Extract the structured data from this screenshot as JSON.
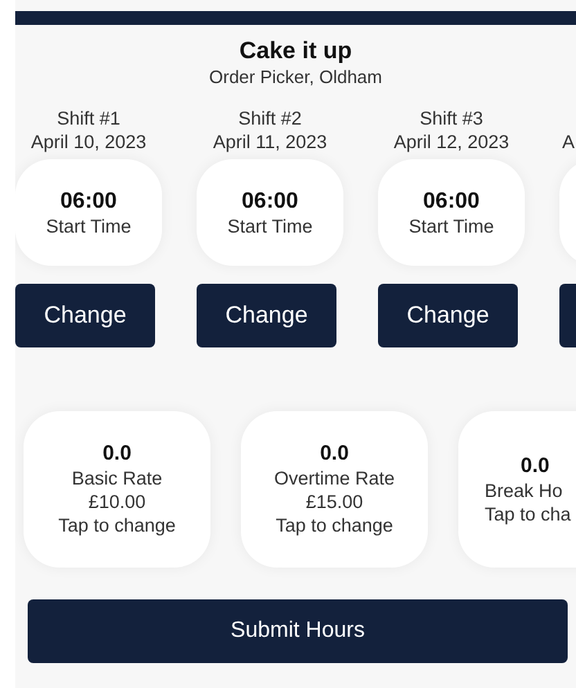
{
  "header": {
    "title": "Cake it up",
    "subtitle": "Order Picker, Oldham"
  },
  "shifts": [
    {
      "label": "Shift #1",
      "date": "April 10, 2023",
      "time": "06:00",
      "time_label": "Start Time",
      "button": "Change"
    },
    {
      "label": "Shift #2",
      "date": "April 11, 2023",
      "time": "06:00",
      "time_label": "Start Time",
      "button": "Change"
    },
    {
      "label": "Shift #3",
      "date": "April 12, 2023",
      "time": "06:00",
      "time_label": "Start Time",
      "button": "Change"
    },
    {
      "date": "A"
    }
  ],
  "rates": [
    {
      "value": "0.0",
      "label": "Basic Rate",
      "amount": "£10.00",
      "hint": "Tap to change"
    },
    {
      "value": "0.0",
      "label": "Overtime Rate",
      "amount": "£15.00",
      "hint": "Tap to change"
    },
    {
      "value": "0.0",
      "label": "Break Ho",
      "hint": "Tap to cha"
    }
  ],
  "submit": "Submit Hours"
}
